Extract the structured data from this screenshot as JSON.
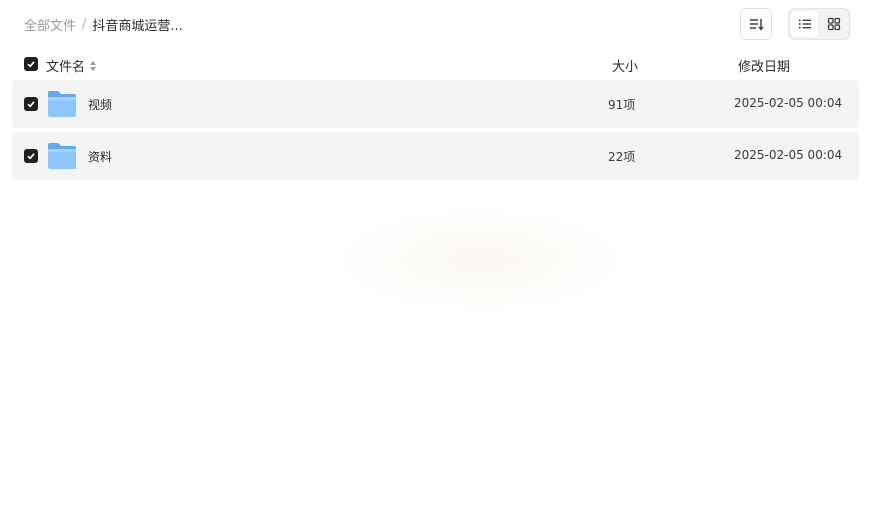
{
  "breadcrumb": {
    "root": "全部文件",
    "separator": "/",
    "current": "抖音商城运营..."
  },
  "toolbar": {
    "sort_icon": "sort-icon",
    "list_view_icon": "list-view-icon",
    "grid_view_icon": "grid-view-icon",
    "active_view": "list"
  },
  "header": {
    "name": "文件名",
    "size": "大小",
    "date": "修改日期"
  },
  "files": [
    {
      "name": "视频",
      "size": "91项",
      "date": "2025-02-05 00:04",
      "icon": "folder-icon",
      "checked": true
    },
    {
      "name": "资料",
      "size": "22项",
      "date": "2025-02-05 00:04",
      "icon": "folder-icon",
      "checked": true
    }
  ],
  "colors": {
    "checkbox": "#1f1f1f",
    "row_bg": "#f4f4f4",
    "folder_top": "#5fa8f2",
    "folder_body": "#8ec5fb"
  }
}
